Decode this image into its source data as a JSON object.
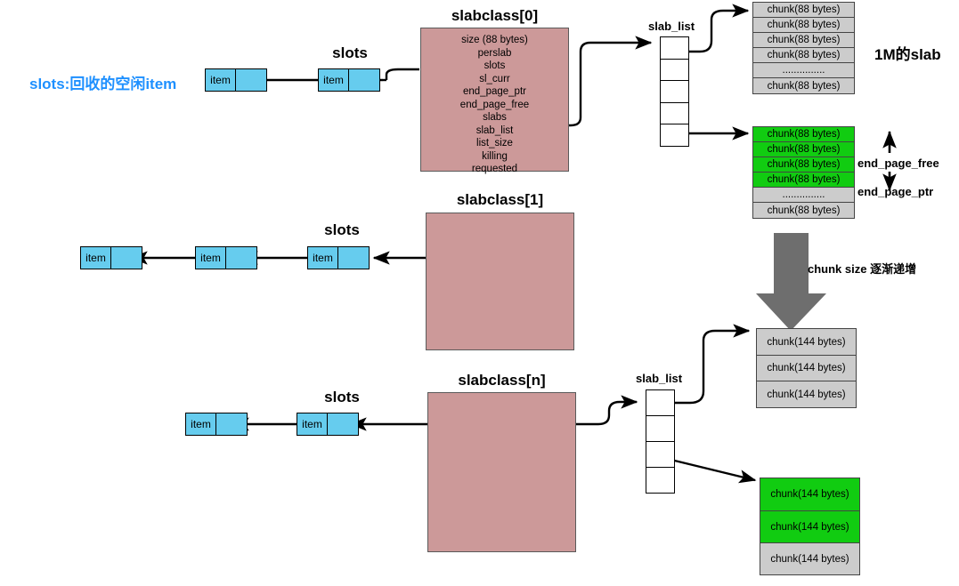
{
  "title": "memcached slab allocator structure diagram",
  "colors": {
    "slabclass_fill": "#cc9999",
    "item_fill": "#66ccee",
    "chunk_used_fill": "#cccccc",
    "chunk_free_fill": "#11cc11",
    "annotation_blue": "#1e90ff",
    "big_arrow": "#6e6e6e"
  },
  "annotations": {
    "slots_note": "slots:回收的空闲item",
    "one_m_slab": "1M的slab",
    "chunk_size_note": "chunk size 逐渐递增",
    "end_page_free": "end_page_free",
    "end_page_ptr": "end_page_ptr"
  },
  "slabclasses": [
    {
      "title": "slabclass[0]",
      "fields": [
        "size (88 bytes)",
        "perslab",
        "slots",
        "sl_curr",
        "end_page_ptr",
        "end_page_free",
        "slabs",
        "slab_list",
        "list_size",
        "killing",
        "requested"
      ],
      "slots_label": "slots",
      "slots_items": [
        {
          "label": "item"
        },
        {
          "label": "item"
        }
      ],
      "slab_list_label": "slab_list",
      "slab_list_cells": 5
    },
    {
      "title": "slabclass[1]",
      "fields": [],
      "slots_label": "slots",
      "slots_items": [
        {
          "label": "item"
        },
        {
          "label": "item"
        },
        {
          "label": "item"
        }
      ],
      "slab_list_label": "",
      "slab_list_cells": 0
    },
    {
      "title": "slabclass[n]",
      "fields": [],
      "slots_label": "slots",
      "slots_items": [
        {
          "label": "item"
        },
        {
          "label": "item"
        }
      ],
      "slab_list_label": "slab_list",
      "slab_list_cells": 4
    }
  ],
  "chunk_stacks": [
    {
      "id": "top-used-slab",
      "rows": [
        {
          "label": "chunk(88 bytes)",
          "free": false
        },
        {
          "label": "chunk(88 bytes)",
          "free": false
        },
        {
          "label": "chunk(88 bytes)",
          "free": false
        },
        {
          "label": "chunk(88 bytes)",
          "free": false
        },
        {
          "label": "...............",
          "free": false
        },
        {
          "label": "chunk(88 bytes)",
          "free": false
        }
      ]
    },
    {
      "id": "top-partial-slab",
      "rows": [
        {
          "label": "chunk(88 bytes)",
          "free": true
        },
        {
          "label": "chunk(88 bytes)",
          "free": true
        },
        {
          "label": "chunk(88 bytes)",
          "free": true
        },
        {
          "label": "chunk(88 bytes)",
          "free": true
        },
        {
          "label": "...............",
          "free": false
        },
        {
          "label": "chunk(88 bytes)",
          "free": false
        }
      ]
    },
    {
      "id": "bottom-used-slab",
      "rows": [
        {
          "label": "chunk(144 bytes)",
          "free": false
        },
        {
          "label": "chunk(144 bytes)",
          "free": false
        },
        {
          "label": "chunk(144 bytes)",
          "free": false
        }
      ]
    },
    {
      "id": "bottom-partial-slab",
      "rows": [
        {
          "label": "chunk(144 bytes)",
          "free": true
        },
        {
          "label": "chunk(144 bytes)",
          "free": true
        },
        {
          "label": "chunk(144 bytes)",
          "free": false
        }
      ]
    }
  ]
}
